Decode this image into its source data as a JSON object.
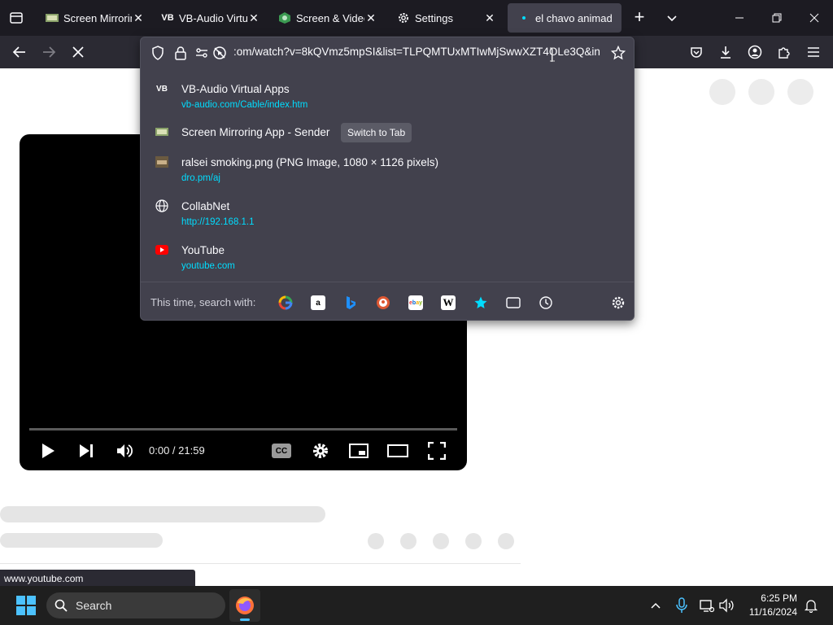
{
  "tabs": [
    {
      "title": "Screen Mirroring",
      "favicon": "screen-mirroring-icon"
    },
    {
      "title": "VB-Audio Virtual",
      "favicon": "vb-audio-icon"
    },
    {
      "title": "Screen & Video",
      "favicon": "screen-video-icon"
    },
    {
      "title": "Settings",
      "favicon": "gear-icon"
    },
    {
      "title": "el chavo animad",
      "favicon": "loading-dot-icon"
    }
  ],
  "vb_badge": "VB",
  "address": {
    "url": ":om/watch?v=8kQVmz5mpSI&list=TLPQMTUxMTIwMjSwwXZT4OLe3Q&in"
  },
  "suggestions": [
    {
      "title": "VB-Audio Virtual Apps",
      "url": "vb-audio.com/Cable/index.htm",
      "icon": "vb-audio-icon"
    },
    {
      "title": "Screen Mirroring App - Sender",
      "url": "",
      "action": "Switch to Tab",
      "icon": "screen-mirroring-icon"
    },
    {
      "title": "ralsei smoking.png (PNG Image, 1080 × 1126 pixels)",
      "url": "dro.pm/aj",
      "icon": "image-icon"
    },
    {
      "title": "CollabNet",
      "url": "http://192.168.1.1",
      "icon": "globe-icon"
    },
    {
      "title": "YouTube",
      "url": "youtube.com",
      "icon": "youtube-icon"
    }
  ],
  "search_with_label": "This time, search with:",
  "search_engines": [
    "google",
    "amazon",
    "bing",
    "duckduckgo",
    "ebay",
    "wikipedia",
    "bookmarks",
    "tabs",
    "history"
  ],
  "player": {
    "time": "0:00 / 21:59",
    "cc_label": "CC"
  },
  "status_url": "www.youtube.com",
  "taskbar": {
    "search_placeholder": "Search",
    "time": "6:25 PM",
    "date": "11/16/2024"
  },
  "colors": {
    "chrome_dark": "#1c1b22",
    "toolbar": "#2b2a33",
    "panel": "#42414d",
    "link": "#00ddff",
    "accent": "#00ddff"
  }
}
